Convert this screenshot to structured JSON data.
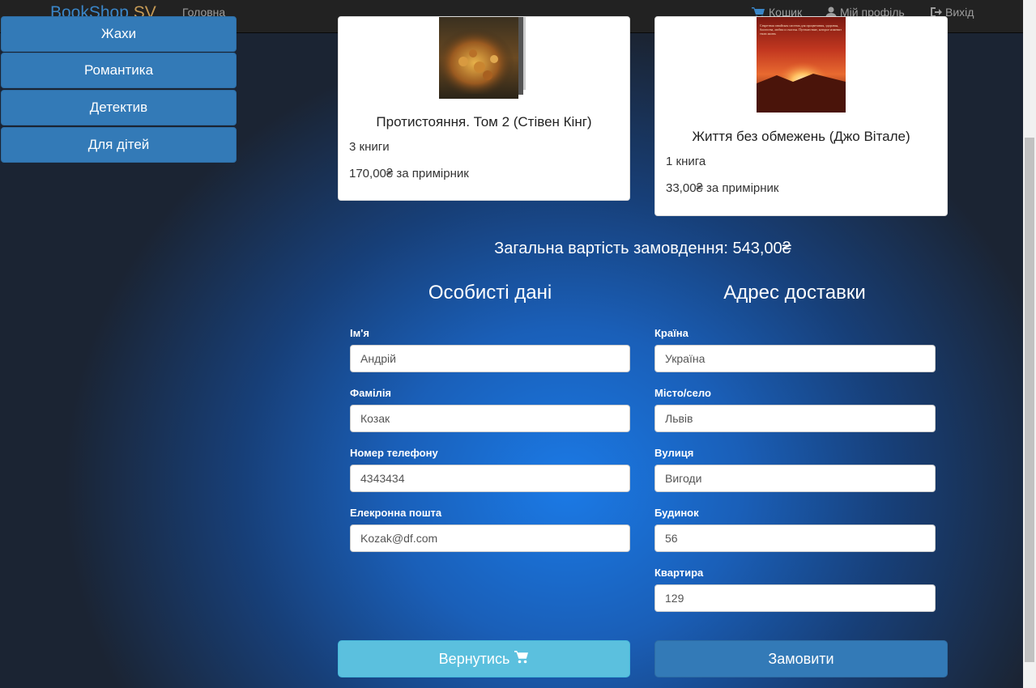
{
  "navbar": {
    "brand_main": "BookShop",
    "brand_accent": "SV",
    "home": "Головна",
    "cart": "Кошик",
    "profile": "Мій профіль",
    "logout": "Вихід"
  },
  "sidebar": {
    "items": [
      {
        "label": "Жахи"
      },
      {
        "label": "Романтика"
      },
      {
        "label": "Детектив"
      },
      {
        "label": "Для дітей"
      }
    ]
  },
  "cart_items": [
    {
      "title": "Протистояння. Том 2 (Стівен Кінг)",
      "quantity": "3 книги",
      "price": "170,00₴ за примірник"
    },
    {
      "title": "Життя без обмежень (Джо Вітале)",
      "quantity": "1 книга",
      "price": "33,00₴ за примірник",
      "cover_text": "Секретная гавайская система для процветания, здоровья, богатства, любви и счастья. Путешествие, которое изменит твою жизнь"
    }
  ],
  "total": "Загальна вартість замовдення: 543,00₴",
  "personal": {
    "title": "Особисті дані",
    "fields": [
      {
        "label": "Ім'я",
        "value": "Андрій"
      },
      {
        "label": "Фамілія",
        "value": "Козак"
      },
      {
        "label": "Номер телефону",
        "value": "4343434"
      },
      {
        "label": "Елекронна пошта",
        "value": "Kozak@df.com"
      }
    ]
  },
  "delivery": {
    "title": "Адрес доставки",
    "fields": [
      {
        "label": "Країна",
        "value": "Україна"
      },
      {
        "label": "Місто/село",
        "value": "Львів"
      },
      {
        "label": "Вулиця",
        "value": "Вигоди"
      },
      {
        "label": "Будинок",
        "value": "56"
      },
      {
        "label": "Квартира",
        "value": "129"
      }
    ]
  },
  "buttons": {
    "back": "Вернутись",
    "order": "Замовити"
  },
  "colors": {
    "primary": "#337ab7",
    "info": "#5bc0de",
    "navbar": "#222222",
    "brand_accent": "#c59a56"
  }
}
